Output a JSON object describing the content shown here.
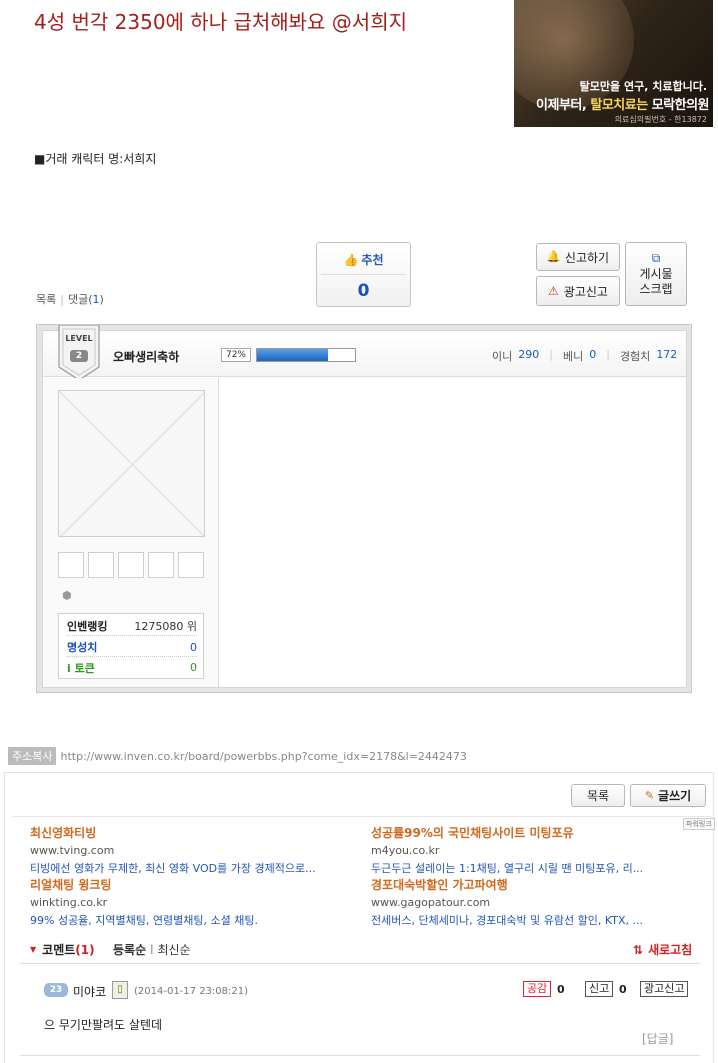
{
  "post": {
    "title": "4성 번각 2350에 하나 급처해봐요 @서희지",
    "trade_line": "■거래 캐릭터 명:서희지"
  },
  "banner": {
    "line1": "탈모만을 연구, 치료합니다.",
    "line2_a": "이제부터, ",
    "line2_b": "탈모치료는",
    "line2_c": " 모락한의원",
    "line3": "의료심의필번호 - 한13872"
  },
  "recommend": {
    "label": "추천",
    "count": "0"
  },
  "actions": {
    "report": "신고하기",
    "ad_report": "광고신고",
    "scrap_line1": "게시물",
    "scrap_line2": "스크랩"
  },
  "listnav": {
    "list": "목록",
    "comments_label": "댓글",
    "comments_open": "(",
    "comments_count": "1",
    "comments_close": ")"
  },
  "profile": {
    "level_text": "LEVEL",
    "level_num": "2",
    "nickname": "오빠생리축하",
    "exp_percent_label": "72%",
    "exp_fraction": 0.72,
    "inni_label": "이니",
    "inni_value": "290",
    "benny_label": "베니",
    "benny_value": "0",
    "exp_label": "경험치",
    "exp_value": "172",
    "rank_label": "인벤랭킹",
    "rank_value": "1275080 위",
    "fame_label": "명성치",
    "fame_value": "0",
    "token_label": "i 토큰",
    "token_value": "0"
  },
  "address": {
    "tag": "주소복사",
    "url": "http://www.inven.co.kr/board/powerbbs.php?come_idx=2178&l=2442473"
  },
  "board_buttons": {
    "list": "목록",
    "write": "글쓰기"
  },
  "ads": {
    "tag": "파워링크",
    "items": [
      {
        "title": "최신영화티빙",
        "url": "www.tving.com",
        "desc": "티빙에선 영화가 무제한, 최신 영화 VOD를 가장 경제적으로..."
      },
      {
        "title": "성공률99%의 국민채팅사이트 미팅포유",
        "url": "m4you.co.kr",
        "desc": "두근두근 설레이는 1:1채팅, 열구리 시릴 땐 미팅포유, 리..."
      },
      {
        "title": "리얼채팅 윙크팅",
        "url": "winkting.co.kr",
        "desc": "99% 성공율, 지역별채팅, 연령별채팅, 소셜 채팅."
      },
      {
        "title": "경포대숙박할인 가고파여행",
        "url": "www.gagopatour.com",
        "desc": "전세버스, 단체세미나, 경포대숙박 및 유람선 할인, KTX, ..."
      }
    ]
  },
  "comments": {
    "header_label": "코멘트",
    "count_text": "(1)",
    "sort_reg": "등록순",
    "sort_sep": "l",
    "sort_new": "최신순",
    "refresh": "새로고침",
    "items": [
      {
        "level": "23",
        "nick": "미야코",
        "date": "(2014-01-17 23:08:21)",
        "like_label": "공감",
        "like_count": "0",
        "report_label": "신고",
        "report_count": "0",
        "adreport_label": "광고신고",
        "body": "으 무기만팔려도 살텐데",
        "reply": "[답글]"
      }
    ]
  }
}
